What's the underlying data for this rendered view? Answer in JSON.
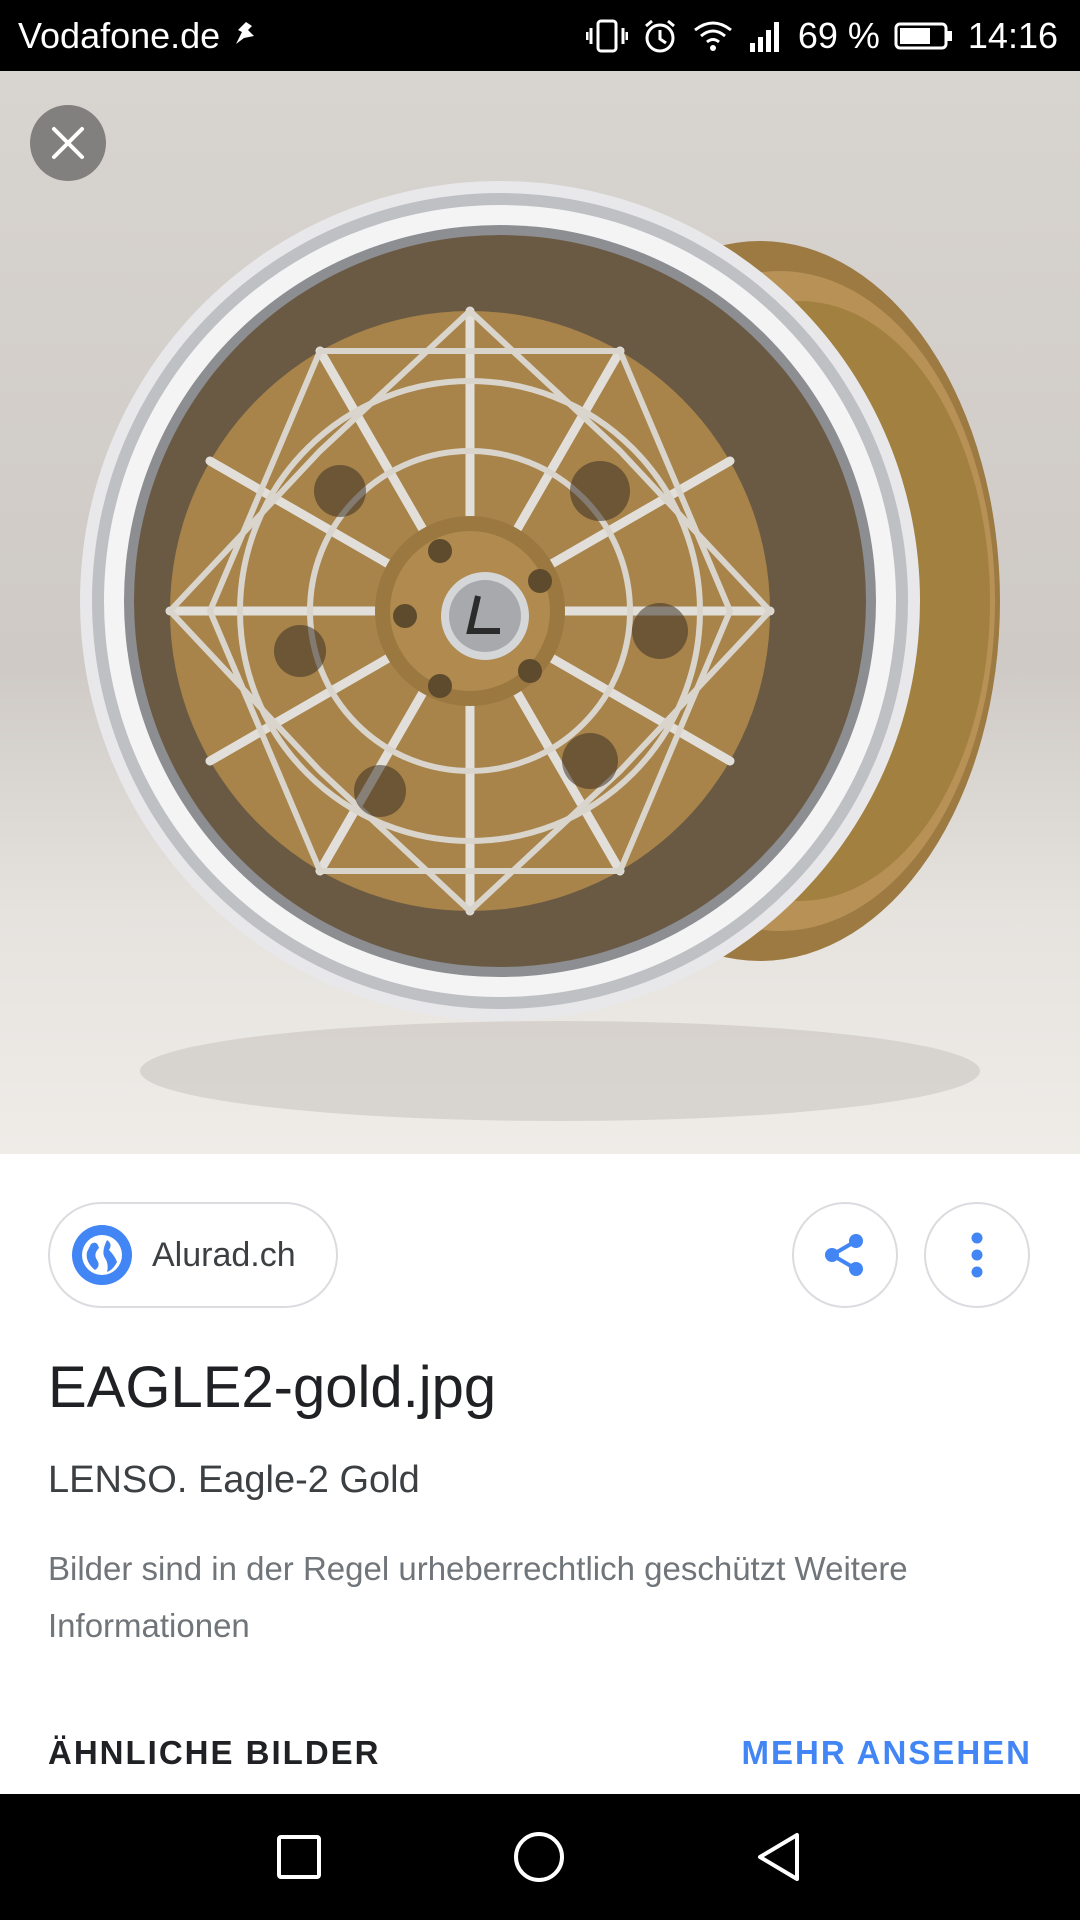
{
  "status_bar": {
    "carrier": "Vodafone.de",
    "battery_percent": "69 %",
    "time": "14:16",
    "icons": [
      "vibrate-icon",
      "alarm-icon",
      "wifi-icon",
      "signal-icon",
      "battery-icon"
    ]
  },
  "viewer": {
    "close_icon": "close-icon"
  },
  "info": {
    "source_name": "Alurad.ch",
    "title": "EAGLE2-gold.jpg",
    "subtitle": "LENSO. Eagle-2 Gold",
    "copyright_text": "Bilder sind in der Regel urheberrechtlich geschützt Weitere Informationen",
    "similar_label": "ÄHNLICHE BILDER",
    "more_label": "MEHR ANSEHEN"
  },
  "colors": {
    "accent": "#4285f4",
    "text_primary": "#202124",
    "text_secondary": "#70757a",
    "wheel_gold": "#a8844a"
  },
  "nav_bar": {
    "buttons": [
      "recents-button",
      "home-button",
      "back-button"
    ]
  }
}
